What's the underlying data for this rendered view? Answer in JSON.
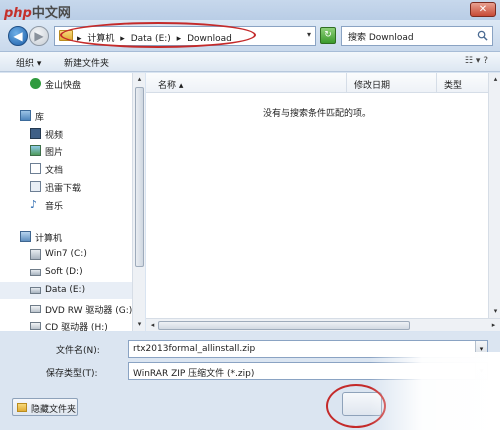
{
  "watermark": {
    "logo": "php",
    "text": "中文网"
  },
  "window": {
    "close_glyph": "✕"
  },
  "nav": {
    "back_glyph": "◀",
    "forward_glyph": "▶",
    "address_crumbs": [
      "▸",
      "计算机",
      "▸",
      "Data (E:)",
      "▸",
      "Download"
    ],
    "address_dropdown_glyph": "▾",
    "refresh_glyph": "↻",
    "search_placeholder": "搜索 Download",
    "annotation_color": "#c42a2a"
  },
  "toolbar": {
    "organize_label": "组织 ▾",
    "new_folder_label": "新建文件夹",
    "view_label": "☷ ▾ ?"
  },
  "sidebar": {
    "items": [
      {
        "label": "金山快盘",
        "icon": "kuaipan-icon",
        "indent": 1
      },
      {
        "label": "库",
        "icon": "library-icon",
        "indent": 0
      },
      {
        "label": "视频",
        "icon": "video-icon",
        "indent": 1
      },
      {
        "label": "图片",
        "icon": "picture-icon",
        "indent": 1
      },
      {
        "label": "文档",
        "icon": "document-icon",
        "indent": 1
      },
      {
        "label": "迅雷下载",
        "icon": "thunder-icon",
        "indent": 1
      },
      {
        "label": "音乐",
        "icon": "music-icon",
        "indent": 1
      },
      {
        "label": "计算机",
        "icon": "computer-icon",
        "indent": 0
      },
      {
        "label": "Win7 (C:)",
        "icon": "drive-system-icon",
        "indent": 1
      },
      {
        "label": "Soft (D:)",
        "icon": "drive-icon",
        "indent": 1
      },
      {
        "label": "Data (E:)",
        "icon": "drive-icon",
        "indent": 1,
        "selected": true
      },
      {
        "label": "DVD RW 驱动器 (G:)",
        "icon": "dvd-icon",
        "indent": 1
      },
      {
        "label": "CD 驱动器 (H:)",
        "icon": "cd-icon",
        "indent": 1
      }
    ]
  },
  "filelist": {
    "columns": [
      "名称 ▴",
      "修改日期",
      "类型"
    ],
    "empty_message": "没有与搜索条件匹配的项。"
  },
  "scroll": {
    "up": "▴",
    "down": "▾",
    "left": "◂",
    "right": "▸"
  },
  "form": {
    "filename_label": "文件名(N):",
    "filename_value": "rtx2013formal_allinstall.zip",
    "filetype_label": "保存类型(T):",
    "filetype_value": "WinRAR ZIP 压缩文件 (*.zip)",
    "dropdown_glyph": "▾",
    "hide_folders_label": "隐藏文件夹"
  }
}
